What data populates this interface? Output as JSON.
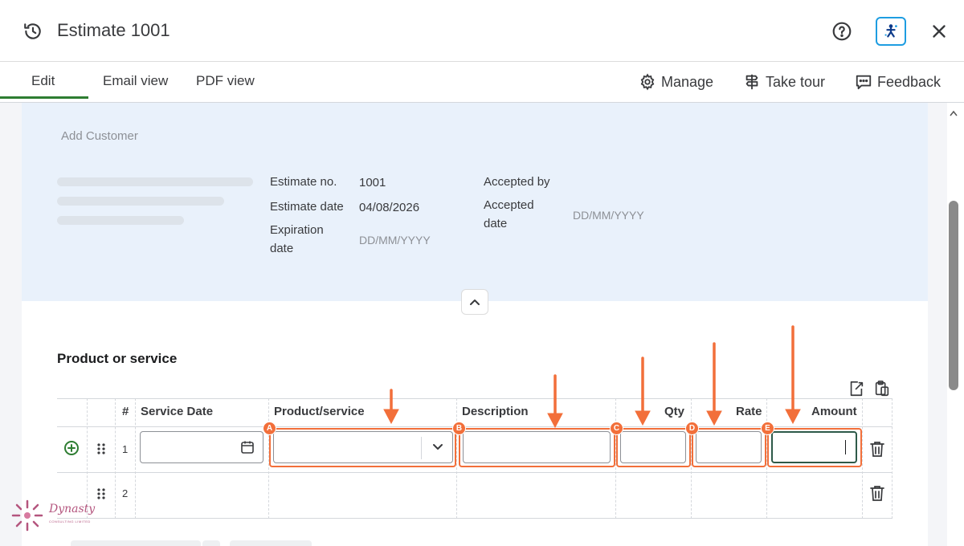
{
  "header": {
    "title": "Estimate 1001",
    "icons": {
      "history": "history-icon",
      "help": "help-icon",
      "assist": "assistant-icon",
      "close": "close-icon"
    }
  },
  "tabs": [
    {
      "label": "Edit",
      "active": true
    },
    {
      "label": "Email view"
    },
    {
      "label": "PDF view"
    }
  ],
  "toolbar": {
    "manage": "Manage",
    "take_tour": "Take tour",
    "feedback": "Feedback"
  },
  "customer": {
    "add_customer": "Add Customer",
    "estimate_no_label": "Estimate no.",
    "estimate_no_value": "1001",
    "estimate_date_label": "Estimate date",
    "estimate_date_value": "04/08/2026",
    "expiration_label_1": "Expiration",
    "expiration_label_2": "date",
    "expiration_placeholder": "DD/MM/YYYY",
    "accepted_by_label": "Accepted by",
    "accepted_date_label_1": "Accepted",
    "accepted_date_label_2": "date",
    "accepted_date_placeholder": "DD/MM/YYYY"
  },
  "products": {
    "section_title": "Product or service",
    "columns": [
      "#",
      "Service Date",
      "Product/service",
      "Description",
      "Qty",
      "Rate",
      "Amount"
    ],
    "rows": [
      {
        "num": "1"
      },
      {
        "num": "2"
      }
    ]
  },
  "annotations": {
    "badges": [
      "A",
      "B",
      "C",
      "D",
      "E"
    ],
    "color": "#f26f3a"
  },
  "branding": {
    "logo_text": "Dynasty",
    "logo_sub": "CONSULTING LIMITED"
  },
  "colors": {
    "accent_green": "#2e7d32",
    "panel_blue": "#e9f1fb",
    "assist_blue": "#1e9de1"
  }
}
